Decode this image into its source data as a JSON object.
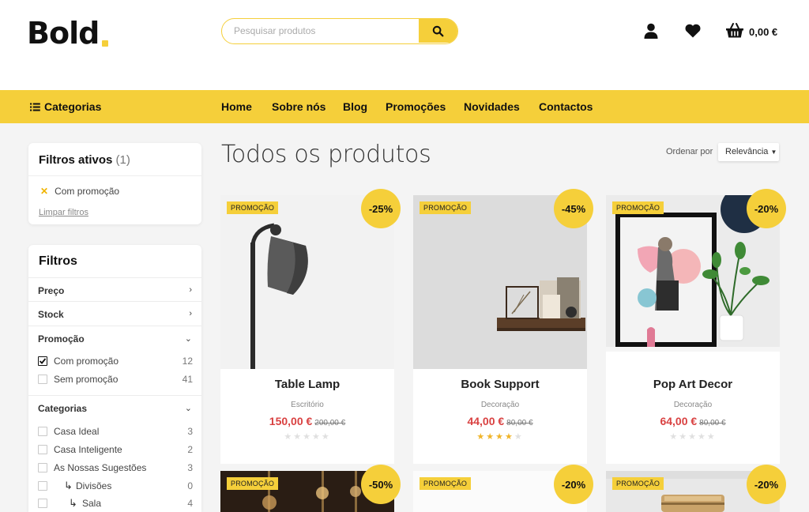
{
  "brand": {
    "name": "Bold"
  },
  "search": {
    "placeholder": "Pesquisar produtos"
  },
  "cart": {
    "total": "0,00 €"
  },
  "nav": {
    "categories_label": "Categorias",
    "links": [
      "Home",
      "Sobre nós",
      "Blog",
      "Promoções",
      "Novidades",
      "Contactos"
    ]
  },
  "active_filters": {
    "title": "Filtros ativos",
    "count": "(1)",
    "items": [
      "Com promoção"
    ],
    "clear_label": "Limpar filtros"
  },
  "filters": {
    "title": "Filtros",
    "groups": [
      {
        "label": "Preço",
        "state": "collapsed"
      },
      {
        "label": "Stock",
        "state": "collapsed"
      },
      {
        "label": "Promoção",
        "state": "expanded"
      },
      {
        "label": "Categorias",
        "state": "expanded"
      }
    ],
    "promo_options": [
      {
        "label": "Com promoção",
        "count": "12",
        "checked": true
      },
      {
        "label": "Sem promoção",
        "count": "41",
        "checked": false
      }
    ],
    "category_options": [
      {
        "label": "Casa Ideal",
        "count": "3"
      },
      {
        "label": "Casa Inteligente",
        "count": "2"
      },
      {
        "label": "As Nossas Sugestões",
        "count": "3"
      },
      {
        "label": "Divisões",
        "count": "0"
      },
      {
        "label": "Sala",
        "count": "4"
      }
    ]
  },
  "main": {
    "title": "Todos os produtos"
  },
  "sort": {
    "label": "Ordenar por",
    "value": "Relevância"
  },
  "products": [
    {
      "tag": "PROMOÇÃO",
      "discount": "-25%",
      "name": "Table Lamp",
      "category": "Escritório",
      "price": "150,00 €",
      "old_price": "200,00 €",
      "rating": 0
    },
    {
      "tag": "PROMOÇÃO",
      "discount": "-45%",
      "name": "Book Support",
      "category": "Decoração",
      "price": "44,00 €",
      "old_price": "80,00 €",
      "rating": 4
    },
    {
      "tag": "PROMOÇÃO",
      "discount": "-20%",
      "name": "Pop Art Decor",
      "category": "Decoração",
      "price": "64,00 €",
      "old_price": "80,00 €",
      "rating": 0
    },
    {
      "tag": "PROMOÇÃO",
      "discount": "-50%"
    },
    {
      "tag": "PROMOÇÃO",
      "discount": "-20%"
    },
    {
      "tag": "PROMOÇÃO",
      "discount": "-20%"
    }
  ],
  "colors": {
    "accent": "#f5cf3a",
    "price": "#d94141",
    "star": "#f0b429"
  },
  "icons": [
    "search-icon",
    "user-icon",
    "heart-icon",
    "cart-icon",
    "list-icon",
    "chevron-right-icon",
    "chevron-down-icon",
    "close-icon",
    "check-icon",
    "subcategory-arrow-icon",
    "star-icon"
  ]
}
